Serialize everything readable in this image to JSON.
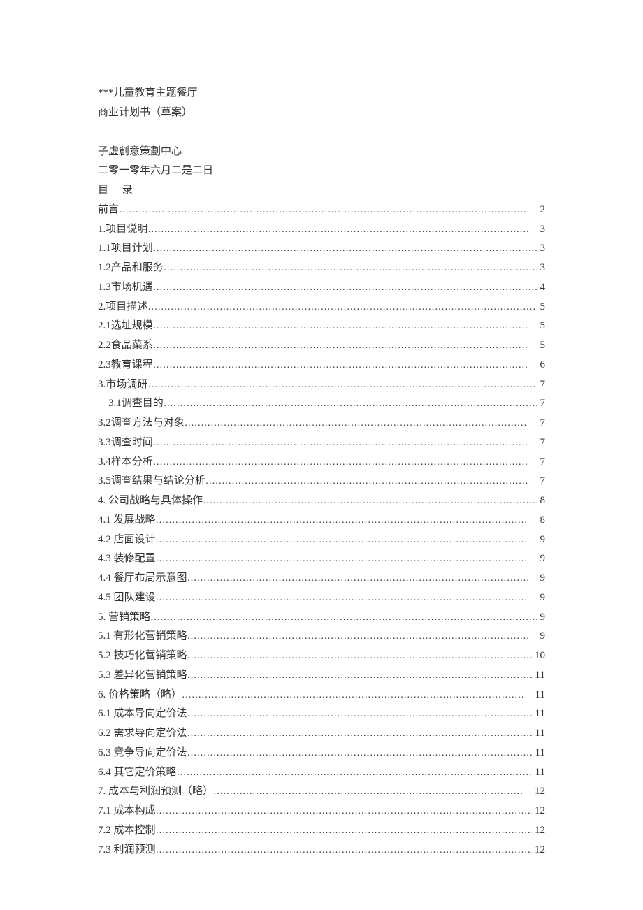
{
  "header": {
    "title1": "***儿童教育主题餐厅",
    "title2": "商业计划书（草案）",
    "org": "子虛創意策劃中心",
    "date": "二零一零年六月二是二日",
    "toc_title": "目  录"
  },
  "toc": [
    {
      "label": "前言",
      "page": "2",
      "gap": "widegap"
    },
    {
      "label": "1.项目说明",
      "page": "3",
      "gap": "widegap"
    },
    {
      "label": "1.1项目计划",
      "page": "3"
    },
    {
      "label": "1.2产品和服务",
      "page": "3"
    },
    {
      "label": "1.3市场机遇",
      "page": "4"
    },
    {
      "label": "2.项目描述  ",
      "page": "5"
    },
    {
      "label": "2.1选址规模  ",
      "page": "5",
      "gap": "widegap"
    },
    {
      "label": "2.2食品菜系  ",
      "page": "5",
      "gap": "widegap"
    },
    {
      "label": "2.3教育课程  ",
      "page": "6",
      "gap": "widegap"
    },
    {
      "label": "3.市场调研  ",
      "page": "7"
    },
    {
      "label": "3.1调查目的  ",
      "page": "7",
      "indent": true
    },
    {
      "label": "3.2调查方法与对象",
      "page": "7",
      "gap": "widegap"
    },
    {
      "label": "3.3调查时间  ",
      "page": "7",
      "gap": "widegap"
    },
    {
      "label": "3.4样本分析",
      "page": "7",
      "gap": "widegap"
    },
    {
      "label": "3.5调查结果与结论分析",
      "page": "7",
      "gap": "widegap"
    },
    {
      "label": "4.   公司战略与具体操作",
      "page": "8"
    },
    {
      "label": "4.1  发展战略",
      "page": "8",
      "gap": "widegap"
    },
    {
      "label": "4.2  店面设计",
      "page": "9",
      "gap": "widegap"
    },
    {
      "label": "4.3  装修配置",
      "page": "9",
      "gap": "widegap"
    },
    {
      "label": "4.4  餐厅布局示意图",
      "page": "9",
      "gap": "widegap"
    },
    {
      "label": "4.5  团队建设",
      "page": "9",
      "gap": "widegap"
    },
    {
      "label": "5.  营销策略",
      "page": "9"
    },
    {
      "label": "5.1  有形化营销策略",
      "page": "9",
      "gap": "widegap"
    },
    {
      "label": "5.2  技巧化营销策略",
      "page": "10"
    },
    {
      "label": "5.3  差异化营销策略",
      "page": "11"
    },
    {
      "label": "6. 价格策略（略）",
      "page": "11",
      "gap": "widegap"
    },
    {
      "label": "6.1  成本导向定价法",
      "page": "11"
    },
    {
      "label": "6.2  需求导向定价法",
      "page": "11"
    },
    {
      "label": "6.3  竞争导向定价法",
      "page": "11"
    },
    {
      "label": "6.4  其它定价策略",
      "page": "11"
    },
    {
      "label": "7. 成本与利润预测（略）",
      "page": "12",
      "gap": "widegap"
    },
    {
      "label": "7.1  成本构成",
      "page": "12"
    },
    {
      "label": "7.2  成本控制",
      "page": "12"
    },
    {
      "label": "7.3  利润预测",
      "page": "12"
    }
  ]
}
